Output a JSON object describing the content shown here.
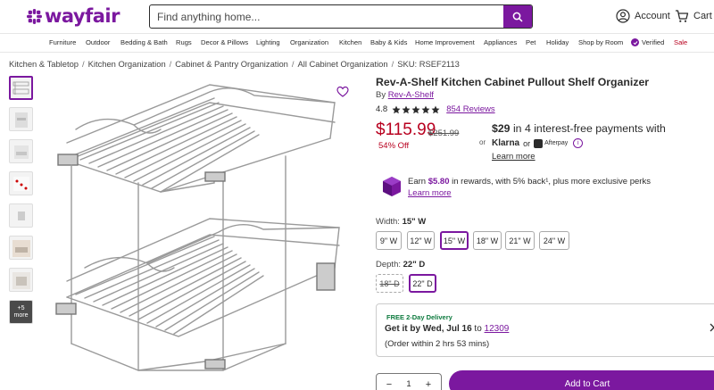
{
  "brand": {
    "name": "wayfair",
    "accent_color": "#7b189f",
    "sale_color": "#b8001f"
  },
  "search": {
    "placeholder": "Find anything home...",
    "icon": "search-icon"
  },
  "account": {
    "label": "Account",
    "icon": "user-icon"
  },
  "cart": {
    "label": "Cart",
    "icon": "cart-icon"
  },
  "nav": {
    "items": [
      "Furniture",
      "Outdoor",
      "Bedding & Bath",
      "Rugs",
      "Decor & Pillows",
      "Lighting",
      "Organization",
      "Kitchen",
      "Baby & Kids",
      "Home Improvement",
      "Appliances",
      "Pet",
      "Holiday",
      "Shop by Room",
      "Verified",
      "Sale"
    ]
  },
  "breadcrumb": [
    "Kitchen & Tabletop",
    "Kitchen Organization",
    "Cabinet & Pantry Organization",
    "All Cabinet Organization",
    "SKU: RSEF2113"
  ],
  "gallery": {
    "more_label": "+5 more",
    "thumb_count": 8
  },
  "product": {
    "title": "Rev-A-Shelf Kitchen Cabinet Pullout Shelf Organizer",
    "by_prefix": "By",
    "brand": "Rev-A-Shelf",
    "rating": "4.8",
    "stars": 5,
    "reviews": "854 Reviews",
    "price": "$115.99",
    "was_price": "$251.99",
    "discount": "54% Off",
    "or": "or",
    "installment_amount": "$29",
    "installment_text": "in 4 interest-free payments with",
    "klarna": "Klarna",
    "or2": "or",
    "afterpay": "Afterpay",
    "learn_more": "Learn more"
  },
  "rewards": {
    "prefix": "Earn",
    "amount": "$5.80",
    "suffix": "in rewards, with 5% back¹, plus more exclusive perks",
    "learn_more": "Learn more"
  },
  "width": {
    "label": "Width:",
    "selected": "15\" W",
    "options": [
      "9\" W",
      "12\" W",
      "15\" W",
      "18\" W",
      "21\" W",
      "24\" W"
    ]
  },
  "depth": {
    "label": "Depth:",
    "selected": "22\" D",
    "options": [
      "18\" D",
      "22\" D"
    ]
  },
  "delivery": {
    "badge": "FREE 2-Day Delivery",
    "prefix": "Get it by",
    "date": "Wed, Jul 16",
    "to": "to",
    "zip": "12309",
    "window": "(Order within 2 hrs 53 mins)"
  },
  "quantity": {
    "value": "1",
    "minus": "−",
    "plus": "+"
  },
  "add_to_cart": "Add to Cart"
}
